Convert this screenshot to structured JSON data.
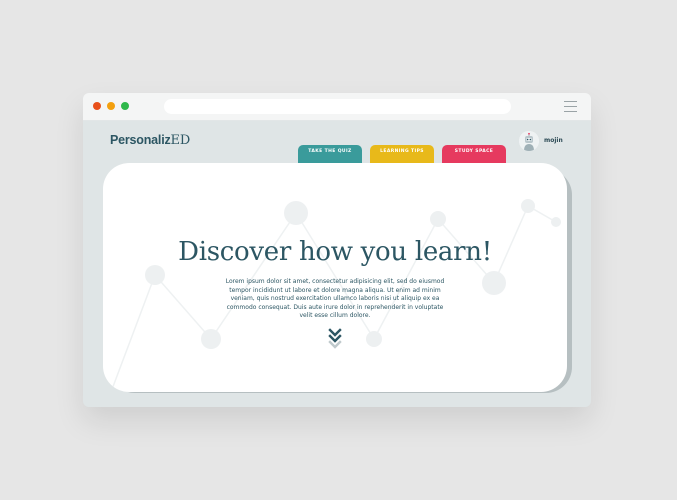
{
  "browser": {
    "controls": [
      "close",
      "minimize",
      "maximize"
    ],
    "url": "",
    "menu_icon": "hamburger-icon"
  },
  "brand": {
    "logo_text": "Personaliz",
    "logo_suffix": "ED"
  },
  "nav": {
    "tabs": [
      {
        "label": "TAKE THE QUIZ",
        "color": "#3a9b9b"
      },
      {
        "label": "LEARNING TIPS",
        "color": "#e8b91a"
      },
      {
        "label": "STUDY SPACE",
        "color": "#e63a5f"
      }
    ]
  },
  "user": {
    "name": "mojin",
    "avatar_icon": "robot-avatar-icon"
  },
  "hero": {
    "title": "Discover how you learn!",
    "body": "Lorem ipsum dolor sit amet, consectetur adipisicing elit, sed do eiusmod tempor incididunt ut labore et dolore magna aliqua. Ut enim ad minim veniam, quis nostrud exercitation ullamco laboris nisi ut aliquip ex ea commodo consequat. Duis aute irure dolor in reprehenderit in voluptate velit esse cillum dolore.",
    "scroll_icon": "chevron-down-double-icon"
  },
  "colors": {
    "primary": "#2c5663",
    "quiz": "#3a9b9b",
    "tips": "#e8b91a",
    "study": "#e63a5f",
    "window_bg": "#dfe5e6"
  }
}
